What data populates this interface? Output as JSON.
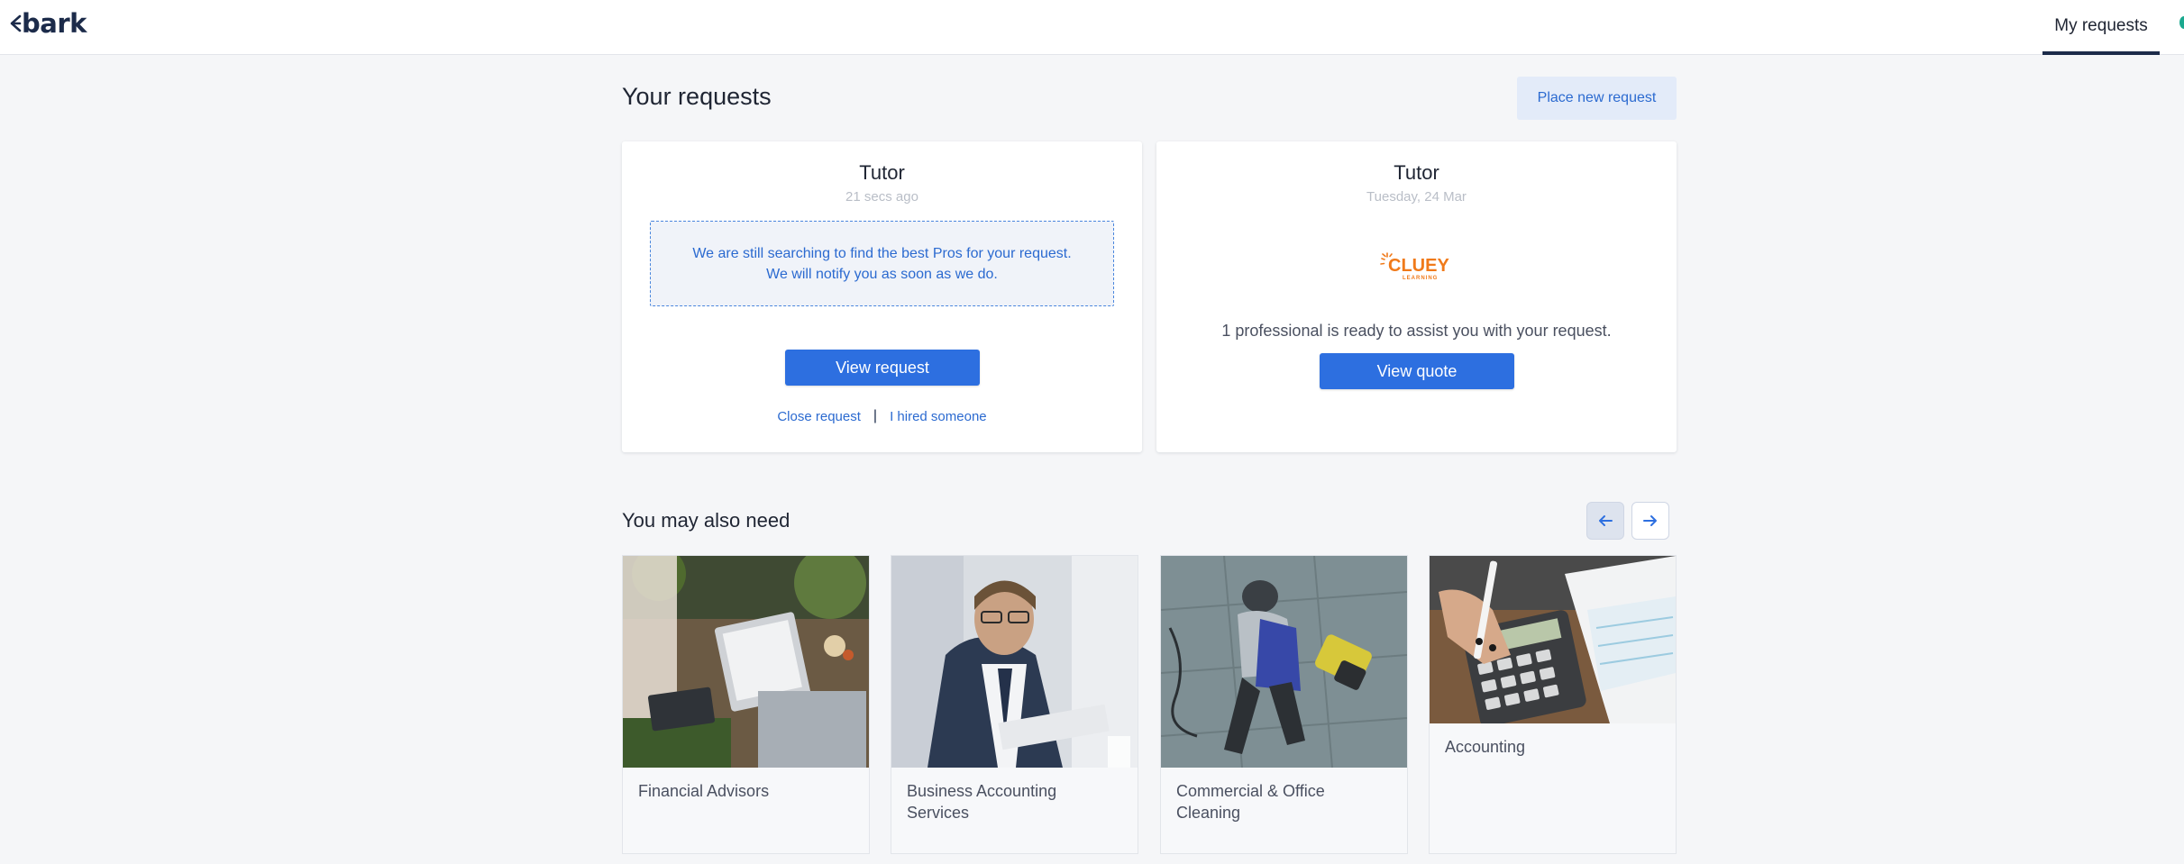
{
  "header": {
    "logo_text": "bark",
    "nav_my_requests": "My requests"
  },
  "main": {
    "title": "Your requests",
    "new_request_label": "Place new request"
  },
  "requests": [
    {
      "title": "Tutor",
      "time": "21 secs ago",
      "notice_line1": "We are still searching to find the best Pros for your request.",
      "notice_line2": "We will notify you as soon as we do.",
      "view_label": "View request",
      "close_label": "Close request",
      "separator": "|",
      "hired_label": "I hired someone"
    },
    {
      "title": "Tutor",
      "time": "Tuesday, 24 Mar",
      "provider_logo": "CLUEY LEARNING",
      "ready_text": "1 professional is ready to assist you with your request.",
      "quote_label": "View quote"
    }
  ],
  "also_need": {
    "title": "You may also need",
    "prev_icon": "arrow-left-icon",
    "next_icon": "arrow-right-icon",
    "items": [
      {
        "label": "Financial Advisors"
      },
      {
        "label": "Business Accounting Services"
      },
      {
        "label": "Commercial & Office Cleaning"
      },
      {
        "label": "Accounting"
      }
    ]
  },
  "colors": {
    "primary": "#2d6fe0",
    "link": "#2b6ad0",
    "brand_dark": "#1c2b4a",
    "cluey_orange": "#f07a1a"
  }
}
